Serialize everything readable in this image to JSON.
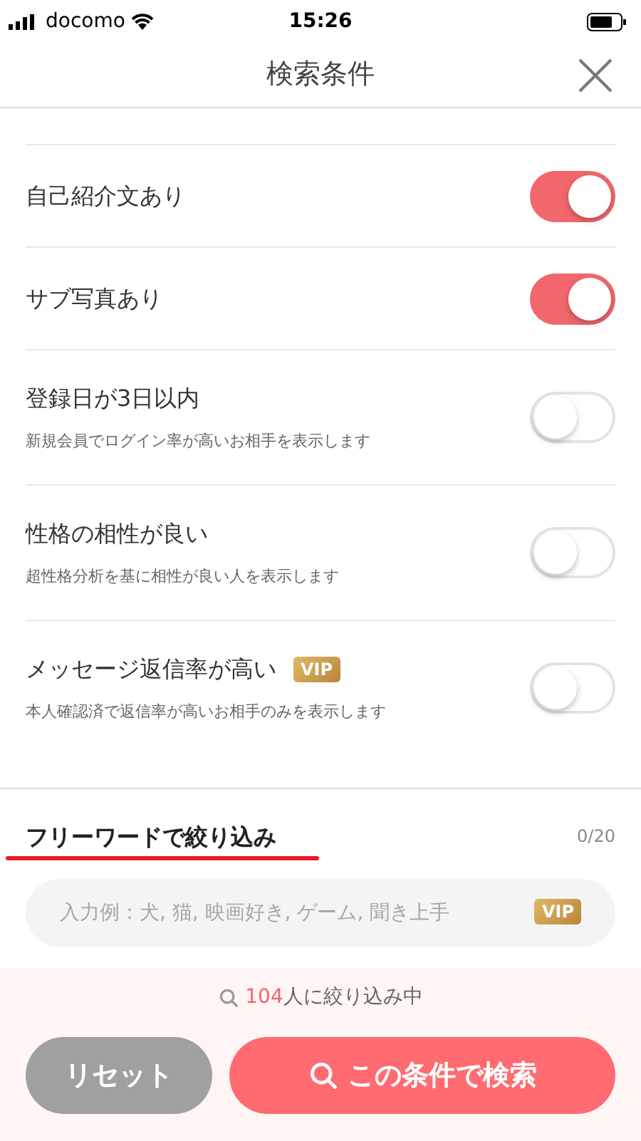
{
  "status_bar": {
    "carrier": "docomo",
    "time": "15:26"
  },
  "header": {
    "title": "検索条件"
  },
  "options": [
    {
      "label": "自己紹介文あり",
      "on": true
    },
    {
      "label": "サブ写真あり",
      "on": true
    },
    {
      "label": "登録日が3日以内",
      "description": "新規会員でログイン率が高いお相手を表示します",
      "on": false
    },
    {
      "label": "性格の相性が良い",
      "description": "超性格分析を基に相性が良い人を表示します",
      "on": false
    },
    {
      "label": "メッセージ返信率が高い",
      "badge": "VIP",
      "description": "本人確認済で返信率が高いお相手のみを表示します",
      "on": false
    }
  ],
  "free_word": {
    "title": "フリーワードで絞り込み",
    "counter": "0/20",
    "placeholder": "入力例：犬, 猫, 映画好き, ゲーム, 聞き上手",
    "badge": "VIP"
  },
  "footer": {
    "count": "104",
    "count_suffix": "人に絞り込み中",
    "buttons": [
      {
        "kind": "reset",
        "label": "リセット"
      },
      {
        "kind": "search",
        "label": "この条件で検索"
      }
    ]
  }
}
